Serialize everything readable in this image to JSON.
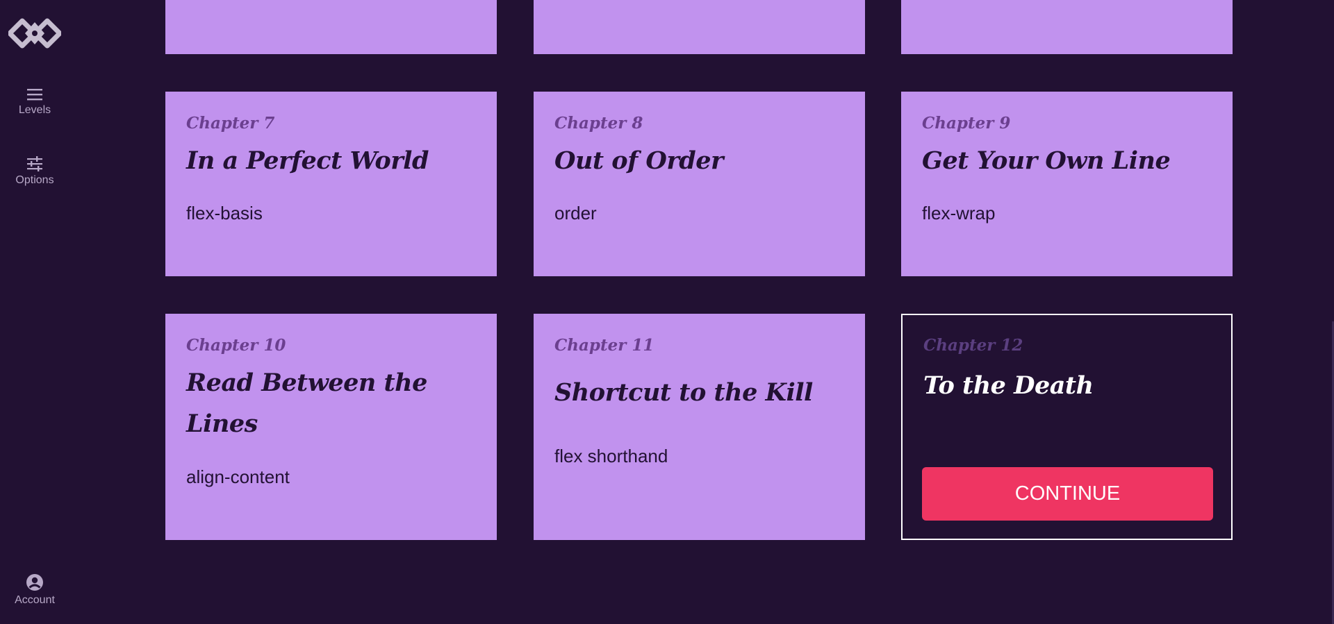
{
  "sidebar": {
    "logo_icon": "diamond-logo-icon",
    "items": [
      {
        "label": "Levels",
        "icon": "hamburger-icon"
      },
      {
        "label": "Options",
        "icon": "sliders-icon"
      }
    ],
    "account": {
      "label": "Account",
      "icon": "user-circle-icon"
    }
  },
  "cards": {
    "c7": {
      "chapter": "Chapter 7",
      "title": "In a Perfect World",
      "property": "flex-basis"
    },
    "c8": {
      "chapter": "Chapter 8",
      "title": "Out of Order",
      "property": "order"
    },
    "c9": {
      "chapter": "Chapter 9",
      "title": "Get Your Own Line",
      "property": "flex-wrap"
    },
    "c10": {
      "chapter": "Chapter 10",
      "title": "Read Between the Lines",
      "property": "align-content"
    },
    "c11": {
      "chapter": "Chapter 11",
      "title": "Shortcut to the Kill",
      "property": "flex shorthand"
    },
    "c12": {
      "chapter": "Chapter 12",
      "title": "To the Death",
      "button": "CONTINUE"
    }
  },
  "colors": {
    "background": "#221133",
    "card": "#c192ee",
    "accent": "#ef3562",
    "chapter_text": "#6b3f8f"
  }
}
